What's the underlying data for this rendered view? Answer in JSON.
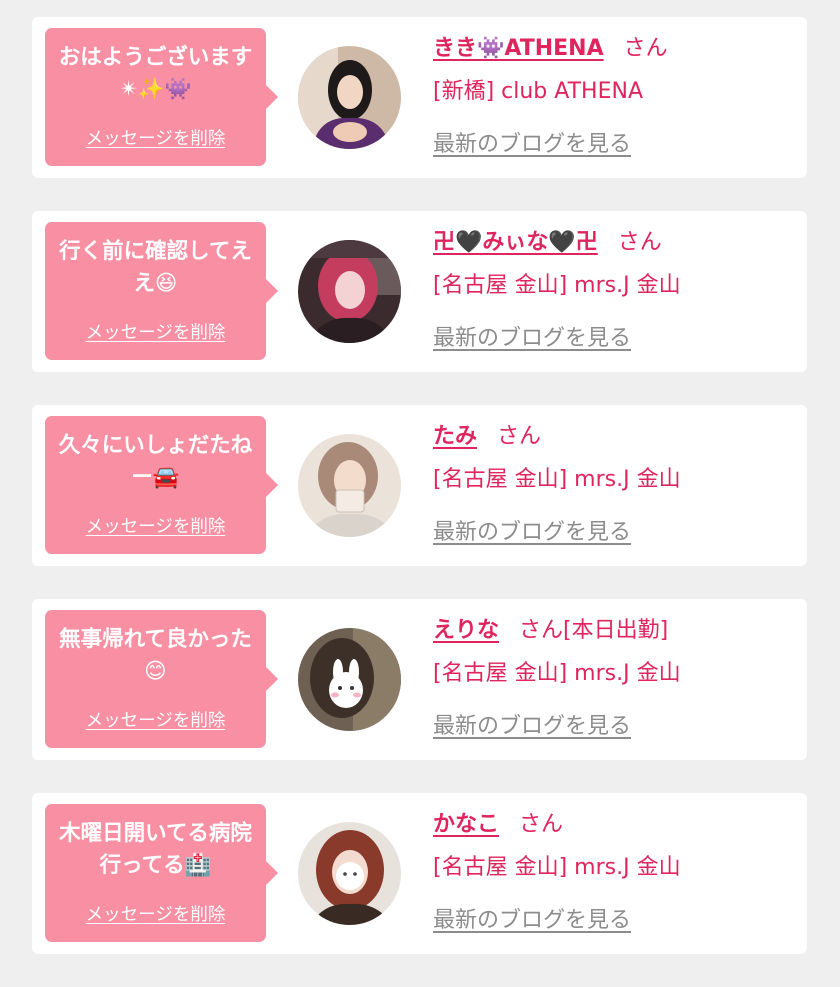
{
  "messages": [
    {
      "message": "おはようございます✴✨👾",
      "delete_label": "メッセージを削除",
      "name": "きき👾ATHENA",
      "honorific": "さん",
      "shop": "[新橋] club ATHENA",
      "blog_label": "最新のブログを見る",
      "avatar_colors": [
        "#cdb9a6",
        "#5a2d6e"
      ]
    },
    {
      "message": "行く前に確認してええ😆",
      "delete_label": "メッセージを削除",
      "name": "卍🖤みぃな🖤卍",
      "honorific": "さん",
      "shop": "[名古屋 金山] mrs.J 金山",
      "blog_label": "最新のブログを見る",
      "avatar_colors": [
        "#3b2a2e",
        "#d0446a"
      ]
    },
    {
      "message": "久々にいしょだたねー🚘",
      "delete_label": "メッセージを削除",
      "name": "たみ",
      "honorific": "さん",
      "shop": "[名古屋 金山] mrs.J 金山",
      "blog_label": "最新のブログを見る",
      "avatar_colors": [
        "#ebe3da",
        "#a98a78"
      ]
    },
    {
      "message": "無事帰れて良かった😊",
      "delete_label": "メッセージを削除",
      "name": "えりな",
      "honorific": "さん[本日出勤]",
      "shop": "[名古屋 金山] mrs.J 金山",
      "blog_label": "最新のブログを見る",
      "avatar_colors": [
        "#6e6153",
        "#3d3028"
      ]
    },
    {
      "message": "木曜日開いてる病院行ってる🏥",
      "delete_label": "メッセージを削除",
      "name": "かなこ",
      "honorific": "さん",
      "shop": "[名古屋 金山] mrs.J 金山",
      "blog_label": "最新のブログを見る",
      "avatar_colors": [
        "#e8e2dc",
        "#8a3a2a"
      ]
    }
  ]
}
